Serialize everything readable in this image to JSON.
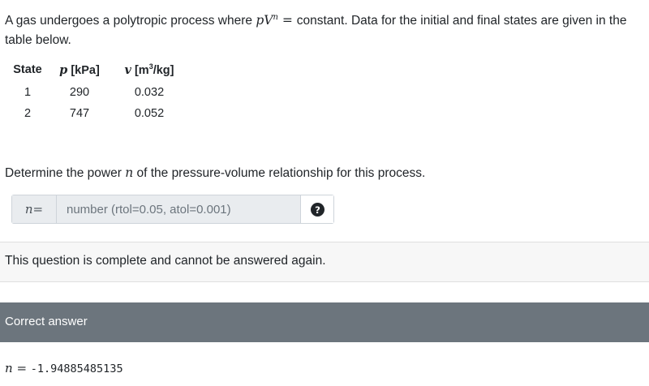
{
  "question": {
    "intro_prefix": "A gas undergoes a polytropic process where ",
    "intro_equation_lhs": "pV",
    "intro_equation_exp": "n",
    "intro_equation_rhs": " = ",
    "intro_suffix": "constant. Data for the initial and final states are given in the table below."
  },
  "table": {
    "headers": {
      "state": "State",
      "p_symbol": "p",
      "p_unit": "[kPa]",
      "v_symbol": "v",
      "v_unit_pre": "[m",
      "v_unit_sup": "3",
      "v_unit_post": "/kg]"
    },
    "rows": [
      {
        "state": "1",
        "p": "290",
        "v": "0.032"
      },
      {
        "state": "2",
        "p": "747",
        "v": "0.052"
      }
    ]
  },
  "prompt": {
    "prefix": "Determine the power ",
    "symbol": "n",
    "suffix": " of the pressure-volume relationship for this process."
  },
  "input": {
    "label_symbol": "n",
    "label_equals": " =",
    "placeholder": "number (rtol=0.05, atol=0.001)",
    "help_icon": "question-circle-icon"
  },
  "status": {
    "message": "This question is complete and cannot be answered again."
  },
  "answer": {
    "header": "Correct answer",
    "symbol": "n",
    "equals": " = ",
    "value": "-1.94885485135"
  },
  "colors": {
    "answer_header_bg": "#6c757d",
    "status_bg": "#f7f7f7",
    "input_bg": "#e9ecef"
  }
}
